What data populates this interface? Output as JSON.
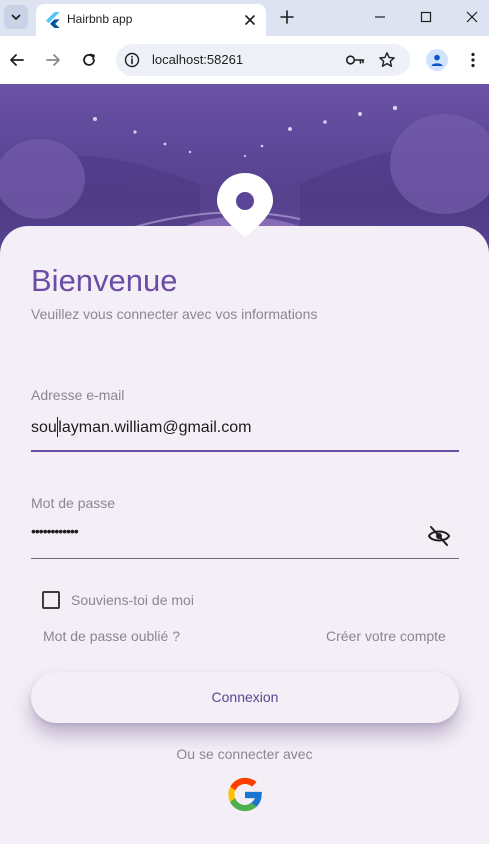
{
  "browser": {
    "tab_title": "Hairbnb app",
    "url": "localhost:58261"
  },
  "icons": {
    "tab_search": "chevron-down-icon",
    "favicon": "flutter-icon",
    "close": "close-icon",
    "new_tab": "plus-icon",
    "back": "arrow-left-icon",
    "forward": "arrow-right-icon",
    "reload": "reload-icon",
    "site_info": "info-icon",
    "password_key": "key-icon",
    "bookmark": "star-icon",
    "profile": "person-icon",
    "menu": "more-vertical-icon",
    "location": "location-pin-icon",
    "visibility": "eye-off-icon",
    "google": "google-icon"
  },
  "colors": {
    "accent": "#6a4ea6",
    "background": "#f4eef7",
    "muted_text": "#8d8691"
  },
  "login": {
    "title": "Bienvenue",
    "subtitle": "Veuillez vous connecter avec vos informations",
    "email_label": "Adresse e-mail",
    "email_value_before_caret": "sou",
    "email_value_after_caret": "layman.william@gmail.com",
    "password_label": "Mot de passe",
    "password_value": "••••••••••••",
    "remember_label": "Souviens-toi de moi",
    "remember_checked": false,
    "forgot_label": "Mot de passe oublié ?",
    "create_label": "Créer votre compte",
    "submit_label": "Connexion",
    "alt_label": "Ou se connecter avec"
  }
}
